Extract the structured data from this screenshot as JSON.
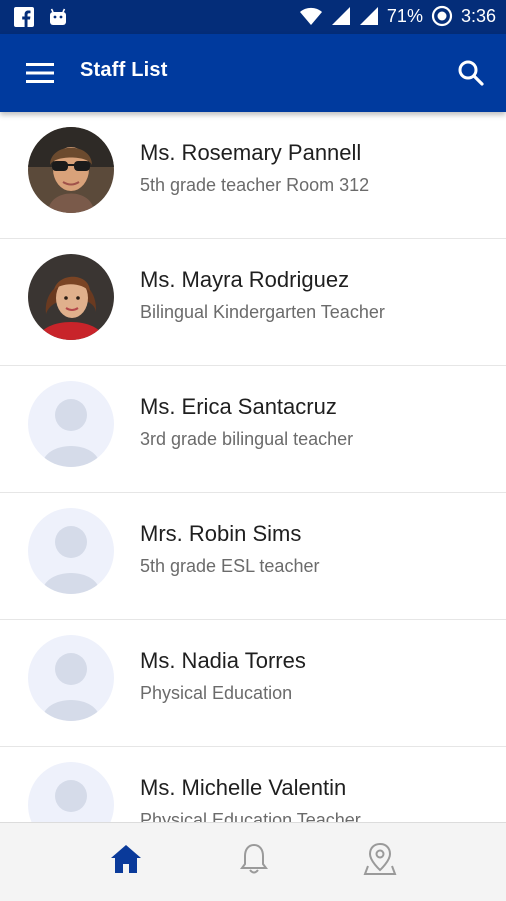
{
  "status_bar": {
    "left_icons": [
      "facebook-icon",
      "android-icon"
    ],
    "battery_text": "71%",
    "time": "3:36"
  },
  "app_bar": {
    "title": "Staff List",
    "menu_icon": "hamburger-icon",
    "search_icon": "search-icon"
  },
  "staff": [
    {
      "name": "Ms. Rosemary Pannell",
      "role": "5th grade teacher Room 312",
      "avatar": "photo"
    },
    {
      "name": "Ms. Mayra Rodriguez",
      "role": "Bilingual Kindergarten Teacher",
      "avatar": "photo"
    },
    {
      "name": "Ms. Erica Santacruz",
      "role": "3rd grade bilingual teacher",
      "avatar": "placeholder"
    },
    {
      "name": "Mrs. Robin Sims",
      "role": "5th grade ESL teacher",
      "avatar": "placeholder"
    },
    {
      "name": "Ms. Nadia Torres",
      "role": "Physical Education",
      "avatar": "placeholder"
    },
    {
      "name": "Ms. Michelle Valentin",
      "role": "Physical Education Teacher",
      "avatar": "placeholder"
    }
  ],
  "bottom_nav": [
    {
      "icon": "home-icon",
      "active": true
    },
    {
      "icon": "bell-icon",
      "active": false
    },
    {
      "icon": "location-pin-icon",
      "active": false
    }
  ],
  "colors": {
    "status_bar": "#042d79",
    "app_bar": "#003a9e",
    "active_nav": "#0a3a9a",
    "inactive_nav": "#9a9a9a",
    "placeholder_bg": "#eef1fb",
    "placeholder_figure": "#d5dbe9"
  }
}
